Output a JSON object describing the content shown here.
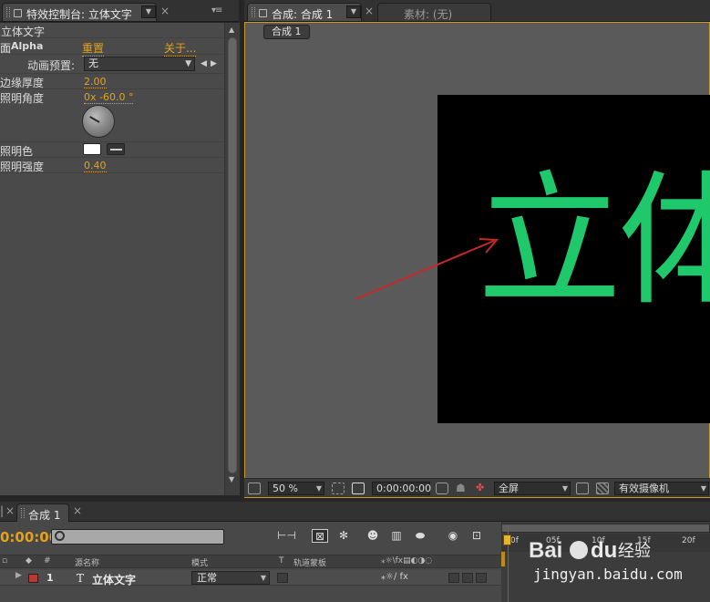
{
  "effect_controls": {
    "tab_title": "特效控制台: 立体文字",
    "layer_name": "立体文字",
    "effect_name": "Alpha",
    "effect_prefix": "面",
    "reset_label": "重置",
    "about_label": "关于...",
    "preset_label": "动画预置:",
    "preset_value": "无",
    "properties": [
      {
        "label": "边缘厚度",
        "value": "2.00"
      },
      {
        "label": "照明角度",
        "value": "0x -60.0 °"
      },
      {
        "label": "照明色",
        "value": ""
      },
      {
        "label": "照明强度",
        "value": "0.40"
      }
    ],
    "light_angle_degrees": -60,
    "light_color": "#ffffff"
  },
  "composition": {
    "tab_title": "合成: 合成 1",
    "footage_tab": "素材: (无)",
    "breadcrumb": "合成 1",
    "canvas_text": "立体",
    "text_color": "#1fc86b",
    "toolbar": {
      "zoom": "50 %",
      "timecode": "0:00:00:00",
      "resolution": "全屏",
      "camera": "有效摄像机"
    }
  },
  "timeline": {
    "left_tab_partial": "|",
    "tab_title": "合成 1",
    "timecode": "0:00:00",
    "columns": {
      "num": "#",
      "source_name": "源名称",
      "mode": "模式",
      "t": "T",
      "trkmat": "轨道蒙板"
    },
    "layer": {
      "number": "1",
      "type_icon": "T",
      "name": "立体文字",
      "mode": "正常",
      "label_color": "#b73a35"
    },
    "ruler_ticks": [
      "0f",
      "05f",
      "10f",
      "15f",
      "20f"
    ]
  },
  "watermark": {
    "brand": "Baidu经验",
    "url": "jingyan.baidu.com"
  }
}
